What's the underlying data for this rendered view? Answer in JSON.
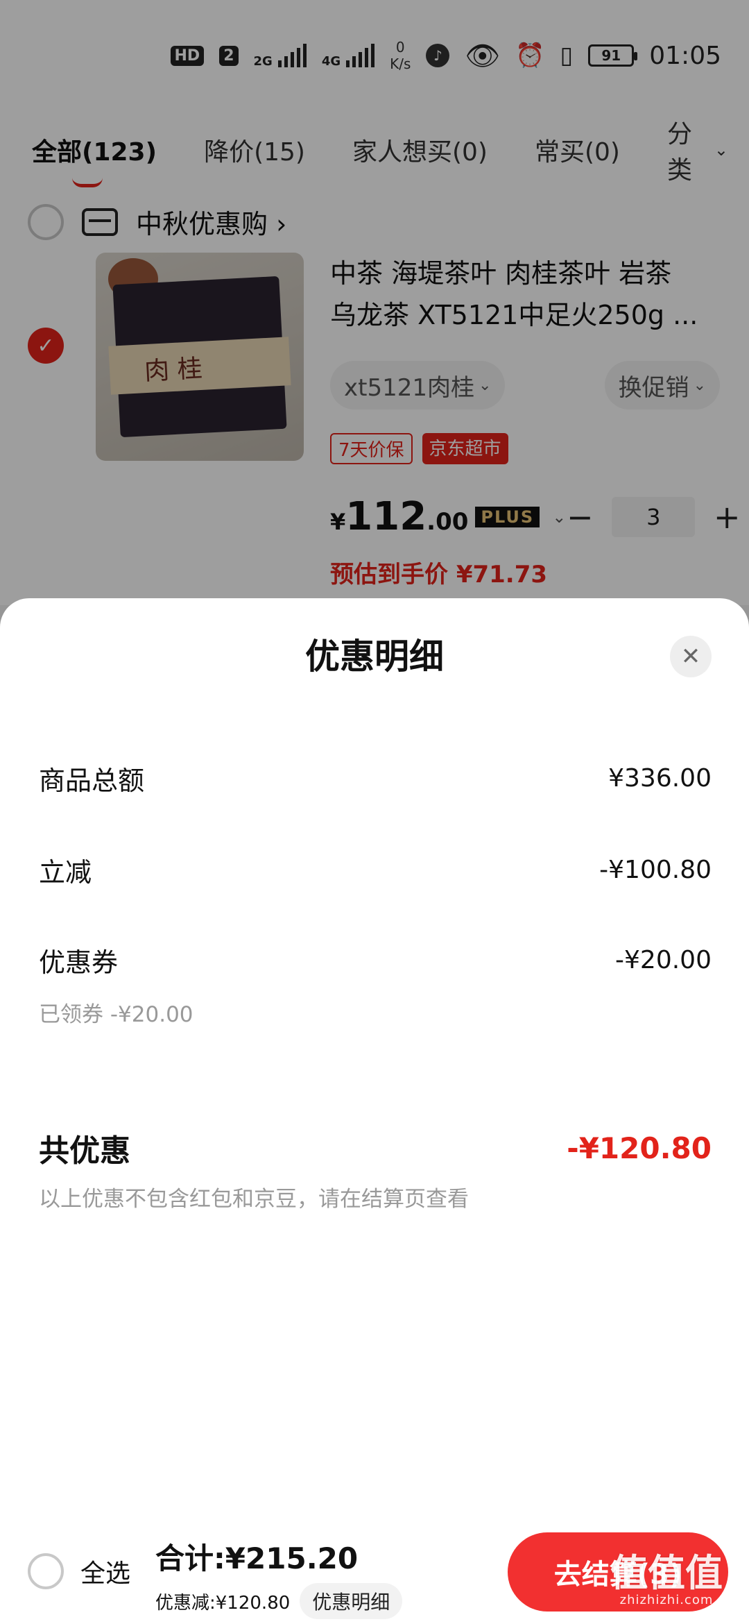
{
  "status_bar": {
    "hd": "HD",
    "sim": "2",
    "net1": "2G",
    "net2": "4G",
    "speed_value": "0",
    "speed_unit": "K/s",
    "battery": "91",
    "time": "01:05",
    "icons": [
      "hd-icon",
      "signal-2g-icon",
      "signal-4g-icon",
      "voice-icon",
      "eye-icon",
      "alarm-icon",
      "vibrate-icon",
      "battery-icon"
    ]
  },
  "tabs": {
    "items": [
      "全部(123)",
      "降价(15)",
      "家人想买(0)",
      "常买(0)"
    ],
    "more": "分类"
  },
  "cart": {
    "store_name": "中秋优惠购 ›",
    "item": {
      "title_line1": "中茶 海堤茶叶 肉桂茶叶 岩茶",
      "title_line2": "乌龙茶 XT5121中足火250g ...",
      "thumb_label": "肉 桂",
      "spec": "xt5121肉桂",
      "promo": "换促销",
      "tags": [
        "7天价保",
        "京东超市"
      ],
      "price_yen": "¥",
      "price_int": "112",
      "price_dec": ".00",
      "plus_badge": "PLUS",
      "quantity": "3",
      "estimate": "预估到手价 ¥71.73"
    }
  },
  "sheet": {
    "title": "优惠明细",
    "rows": [
      {
        "label": "商品总额",
        "value": "¥336.00"
      },
      {
        "label": "立减",
        "value": "-¥100.80"
      },
      {
        "label": "优惠券",
        "value": "-¥20.00",
        "note": "已领券 -¥20.00"
      }
    ],
    "total": {
      "label": "共优惠",
      "value": "-¥120.80"
    },
    "disclaimer": "以上优惠不包含红包和京豆，请在结算页查看"
  },
  "bottom_bar": {
    "select_all": "全选",
    "total": "合计:¥215.20",
    "discount": "优惠减:¥120.80",
    "detail_button": "优惠明细",
    "checkout_button": "去结算(3)"
  },
  "watermark": {
    "glyphs": "值值值",
    "url": "zhizhizhi.com"
  },
  "colors": {
    "accent": "#e2231a",
    "checkout": "#f23030",
    "plus_gold": "#e8c476"
  }
}
